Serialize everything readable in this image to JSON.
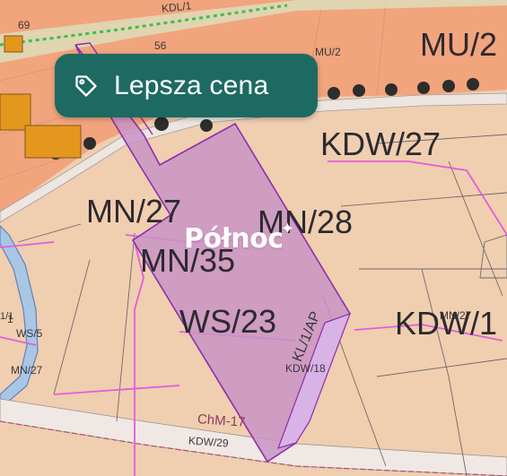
{
  "price_badge": {
    "label": "Lepsza cena",
    "icon": "tag-icon",
    "color": "#1d6a63"
  },
  "watermark": {
    "text": "Północ",
    "spark": "✦"
  },
  "colors": {
    "residential": "#f0ceb0",
    "mixed_use": "#f2a47d",
    "parcel_highlight": "#c993c5",
    "parcel_border": "#8c2fa8",
    "water": "#a9c6e4",
    "building": "#e4971d",
    "survey_line": "#e35ddc"
  },
  "zone_labels": {
    "mu2_top": "MU/2",
    "mu2_big": "MU/2",
    "kdw27_top": "KDW/27",
    "mn27": "MN/27",
    "mn28": "MN/28",
    "mn35": "MN/35",
    "ws23": "WS/23",
    "kdw1": "KDW/1",
    "mn27_small_right": "MN/27",
    "kdw18": "KDW/18",
    "kl1": "KL/1/AP",
    "ws5": "WS/5",
    "mn27_small_left": "MN/27",
    "chm17": "ChM-17",
    "kdw29": "KDW/29",
    "kdl1": "KDL/1",
    "num_56": "56",
    "num_69": "69",
    "one": "1",
    "mn1_left": "1/1"
  }
}
